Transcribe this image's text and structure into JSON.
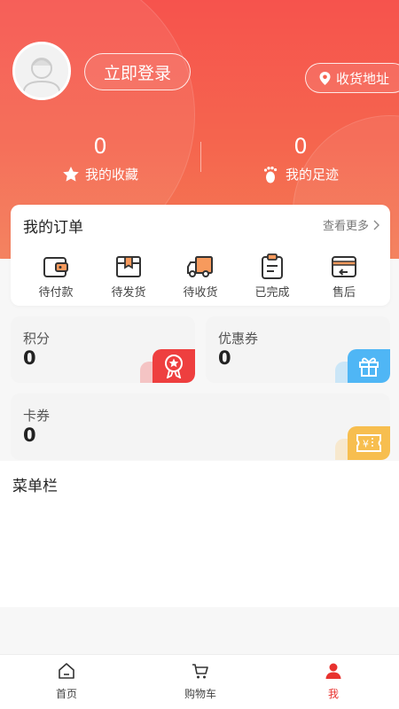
{
  "header": {
    "login_label": "立即登录",
    "address_label": "收货地址",
    "stats": [
      {
        "value": "0",
        "label": "我的收藏",
        "icon": "star-icon"
      },
      {
        "value": "0",
        "label": "我的足迹",
        "icon": "footprint-icon"
      }
    ]
  },
  "orders": {
    "title": "我的订单",
    "more_label": "查看更多",
    "items": [
      {
        "label": "待付款",
        "icon": "wallet-icon"
      },
      {
        "label": "待发货",
        "icon": "package-icon"
      },
      {
        "label": "待收货",
        "icon": "truck-icon"
      },
      {
        "label": "已完成",
        "icon": "clipboard-icon"
      },
      {
        "label": "售后",
        "icon": "return-icon"
      }
    ]
  },
  "assets": {
    "points": {
      "label": "积分",
      "value": "0",
      "icon": "medal-icon"
    },
    "coupons": {
      "label": "优惠券",
      "value": "0",
      "icon": "gift-icon"
    },
    "cards": {
      "label": "卡券",
      "value": "0",
      "icon": "ticket-icon"
    }
  },
  "menu": {
    "title": "菜单栏"
  },
  "tabbar": {
    "items": [
      {
        "label": "首页",
        "icon": "home-icon"
      },
      {
        "label": "购物车",
        "icon": "cart-icon"
      },
      {
        "label": "我",
        "icon": "user-icon"
      }
    ]
  },
  "colors": {
    "brand_red": "#f6534d",
    "active_tab": "#e8322f",
    "coupon_blue": "#4fb6f5",
    "card_yellow": "#f7be4f"
  }
}
